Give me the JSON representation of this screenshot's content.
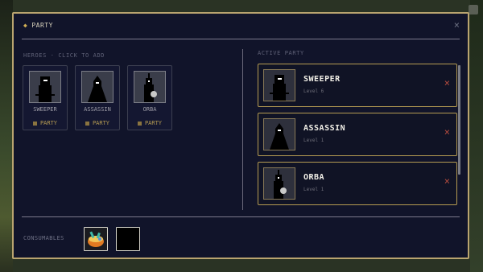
{
  "dialog": {
    "title": "PARTY",
    "close_icon": "×"
  },
  "heroes": {
    "label": "HEROES · CLICK TO ADD",
    "items": [
      {
        "name": "SWEEPER",
        "party_label": "PARTY",
        "icon": "sweeper-figure"
      },
      {
        "name": "ASSASSIN",
        "party_label": "PARTY",
        "icon": "assassin-figure"
      },
      {
        "name": "ORBA",
        "party_label": "PARTY",
        "icon": "orba-figure"
      }
    ]
  },
  "active_party": {
    "label": "ACTIVE PARTY",
    "members": [
      {
        "name": "SWEEPER",
        "level": "Level 6",
        "remove": "×"
      },
      {
        "name": "ASSASSIN",
        "level": "Level 1",
        "remove": "×"
      },
      {
        "name": "ORBA",
        "level": "Level 1",
        "remove": "×"
      }
    ]
  },
  "consumables": {
    "label": "CONSUMABLES",
    "slots": [
      "food-bowl-icon",
      "empty"
    ]
  },
  "colors": {
    "panel_bg": "#11142a",
    "gold_border": "#b9a46f",
    "remove_red": "#b04a3e"
  }
}
